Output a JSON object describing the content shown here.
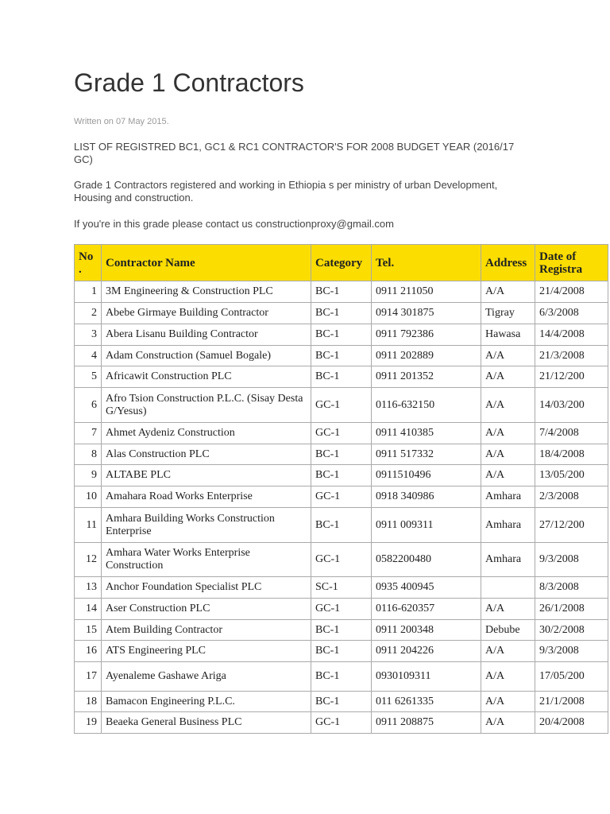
{
  "title": "Grade 1 Contractors",
  "written": "Written on 07 May 2015.",
  "paragraphs": [
    "LIST OF REGISTRED BC1, GC1 & RC1 CONTRACTOR'S FOR 2008 BUDGET YEAR (2016/17 GC)",
    "Grade 1 Contractors registered and working in Ethiopia s per ministry of urban Development, Housing and construction.",
    "If you're in this grade please contact us constructionproxy@gmail.com"
  ],
  "table": {
    "headers": [
      "No .",
      "Contractor Name",
      "Category",
      "Tel.",
      "Address",
      "Date of Registra"
    ],
    "rows": [
      [
        "1",
        "3M Engineering & Construction PLC",
        "BC-1",
        "0911 211050",
        "A/A",
        "21/4/2008"
      ],
      [
        "2",
        "Abebe Girmaye Building Contractor",
        "BC-1",
        "0914 301875",
        "Tigray",
        "6/3/2008"
      ],
      [
        "3",
        "Abera Lisanu Building Contractor",
        "BC-1",
        "0911 792386",
        "Hawasa",
        "14/4/2008"
      ],
      [
        "4",
        "Adam Construction (Samuel Bogale)",
        "BC-1",
        "0911 202889",
        "A/A",
        "21/3/2008"
      ],
      [
        "5",
        "Africawit Construction PLC",
        "BC-1",
        "0911 201352",
        "A/A",
        "21/12/200"
      ],
      [
        "6",
        "Afro Tsion Construction P.L.C. (Sisay Desta G/Yesus)",
        "GC-1",
        "0116-632150",
        "A/A",
        "14/03/200"
      ],
      [
        "7",
        "Ahmet Aydeniz Construction",
        "GC-1",
        "0911 410385",
        "A/A",
        "7/4/2008"
      ],
      [
        "8",
        "Alas Construction PLC",
        "BC-1",
        "0911 517332",
        "A/A",
        "18/4/2008"
      ],
      [
        "9",
        "ALTABE PLC",
        "BC-1",
        "0911510496",
        "A/A",
        "13/05/200"
      ],
      [
        "10",
        "Amahara Road Works Enterprise",
        "GC-1",
        "0918 340986",
        "Amhara",
        "2/3/2008"
      ],
      [
        "11",
        "Amhara Building Works Construction Enterprise",
        "BC-1",
        "0911 009311",
        "Amhara",
        "27/12/200"
      ],
      [
        "12",
        "Amhara Water Works Enterprise Construction",
        "GC-1",
        "0582200480",
        "Amhara",
        "9/3/2008"
      ],
      [
        "13",
        "Anchor Foundation Specialist PLC",
        "SC-1",
        "0935 400945",
        "",
        "8/3/2008"
      ],
      [
        "14",
        "Aser Construction PLC",
        "GC-1",
        "0116-620357",
        "A/A",
        "26/1/2008"
      ],
      [
        "15",
        "Atem Building Contractor",
        "BC-1",
        "0911 200348",
        "Debube",
        "30/2/2008"
      ],
      [
        "16",
        "ATS Engineering PLC",
        "BC-1",
        "0911 204226",
        "A/A",
        "9/3/2008"
      ],
      [
        "17",
        "Ayenaleme Gashawe Ariga",
        "BC-1",
        "0930109311",
        "A/A",
        "17/05/200"
      ],
      [
        "18",
        "Bamacon Engineering P.L.C.",
        "BC-1",
        "011 6261335",
        "A/A",
        "21/1/2008"
      ],
      [
        "19",
        "Beaeka General Business PLC",
        "GC-1",
        "0911 208875",
        "A/A",
        "20/4/2008"
      ]
    ]
  }
}
